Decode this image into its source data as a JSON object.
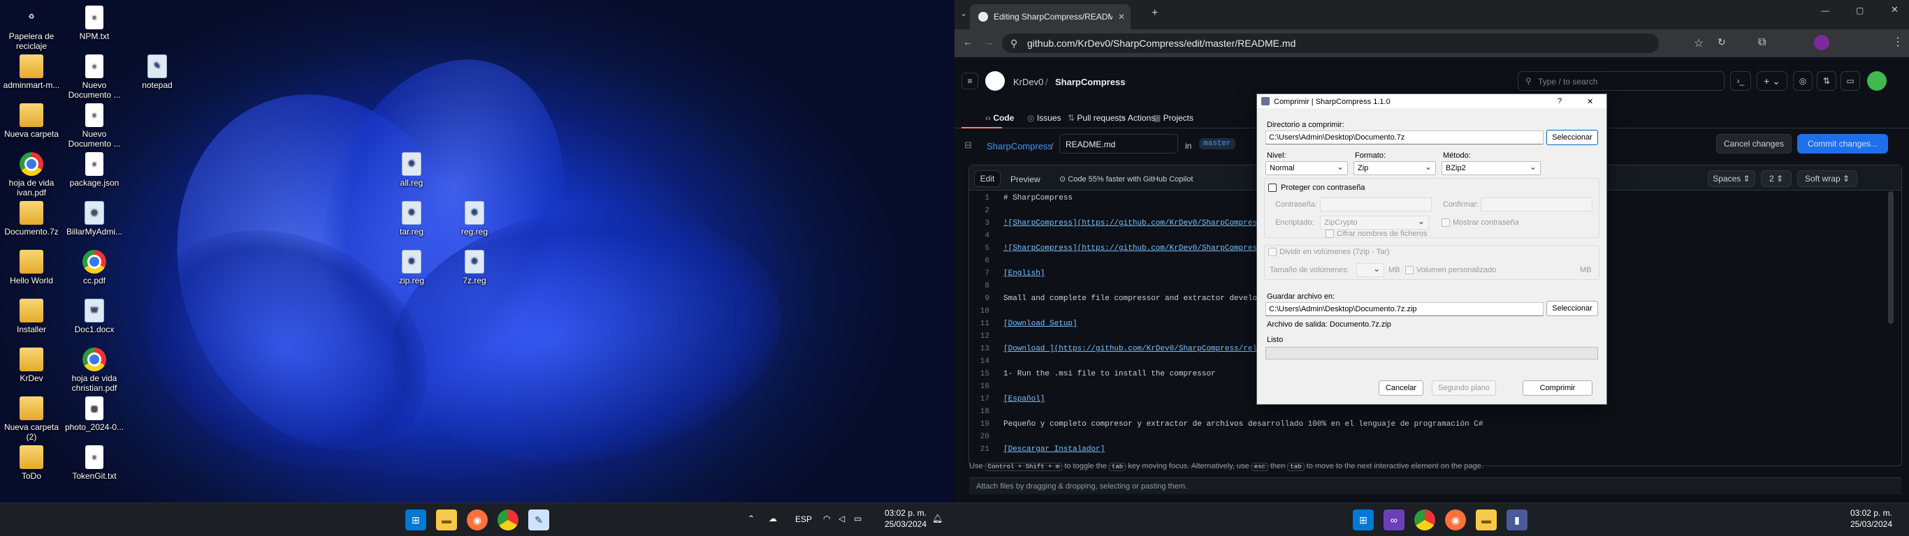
{
  "left_desktop": {
    "icons": [
      {
        "label": "Papelera de reciclaje",
        "kind": "bin",
        "glyph": "♻"
      },
      {
        "label": "NPM.txt",
        "kind": "doc",
        "glyph": "≡"
      },
      {
        "label": "adminmart-m...",
        "kind": "fold",
        "glyph": ""
      },
      {
        "label": "Nuevo Documento ...",
        "kind": "doc",
        "glyph": "≡"
      },
      {
        "label": "notepad",
        "kind": "reg",
        "glyph": "✎"
      },
      {
        "label": "Nueva carpeta",
        "kind": "fold",
        "glyph": ""
      },
      {
        "label": "Nuevo Documento ...",
        "kind": "doc",
        "glyph": "≡"
      },
      {
        "label": "hoja de vida ivan.pdf",
        "kind": "chr",
        "glyph": ""
      },
      {
        "label": "package.json",
        "kind": "doc",
        "glyph": "≡"
      },
      {
        "label": "Documento.7z",
        "kind": "fold",
        "glyph": ""
      },
      {
        "label": "BillarMyAdmi...",
        "kind": "reg",
        "glyph": "◎"
      },
      {
        "label": "Hello World",
        "kind": "fold",
        "glyph": ""
      },
      {
        "label": "cc.pdf",
        "kind": "chr",
        "glyph": ""
      },
      {
        "label": "Installer",
        "kind": "fold",
        "glyph": ""
      },
      {
        "label": "Doc1.docx",
        "kind": "reg",
        "glyph": "W"
      },
      {
        "label": "KrDev",
        "kind": "fold",
        "glyph": ""
      },
      {
        "label": "hoja de vida christian.pdf",
        "kind": "chr",
        "glyph": ""
      },
      {
        "label": "Nueva carpeta (2)",
        "kind": "fold",
        "glyph": ""
      },
      {
        "label": "photo_2024-0...",
        "kind": "doc",
        "glyph": "▦"
      },
      {
        "label": "ToDo",
        "kind": "fold",
        "glyph": ""
      },
      {
        "label": "TokenGit.txt",
        "kind": "doc",
        "glyph": "≡"
      },
      {
        "label": "all.reg",
        "kind": "reg",
        "glyph": "⚙"
      },
      {
        "label": "tar.reg",
        "kind": "reg",
        "glyph": "⚙"
      },
      {
        "label": "reg.reg",
        "kind": "reg",
        "glyph": "⚙"
      },
      {
        "label": "zip.reg",
        "kind": "reg",
        "glyph": "⚙"
      },
      {
        "label": "7z.reg",
        "kind": "reg",
        "glyph": "⚙"
      }
    ],
    "taskbar": {
      "lang": "ESP",
      "time": "03:02 p. m.",
      "date": "25/03/2024"
    }
  },
  "browser": {
    "tab_title": "Editing SharpCompress/README",
    "url": "github.com/KrDev0/SharpCompress/edit/master/README.md",
    "search_placeholder": "Type / to search",
    "owner": "KrDev0",
    "repo": "SharpCompress",
    "nav": [
      "Code",
      "Issues",
      "Pull requests",
      "Actions",
      "Projects"
    ],
    "breadcrumb_repo": "SharpCompress",
    "filename": "README.md",
    "branch_prefix": "in",
    "branch": "master",
    "cancel_label": "Cancel changes",
    "commit_label": "Commit changes...",
    "edit_tab": "Edit",
    "preview_tab": "Preview",
    "copilot_note": "Code 55% faster with GitHub Copilot",
    "indent_mode": "Spaces",
    "indent_size": "2",
    "wrap_mode": "Soft wrap",
    "lines": [
      {
        "n": "1",
        "t": "# SharpCompress",
        "link": false
      },
      {
        "n": "2",
        "t": "",
        "link": false
      },
      {
        "n": "3",
        "t": "![SharpCompress](https://github.com/KrDev0/SharpCompress/blob",
        "link": true
      },
      {
        "n": "4",
        "t": "",
        "link": false
      },
      {
        "n": "5",
        "t": "![SharpCompress](https://github.com/KrDev0/SharpCompress/blob",
        "link": true
      },
      {
        "n": "6",
        "t": "",
        "link": false
      },
      {
        "n": "7",
        "t": "[English]",
        "link": true
      },
      {
        "n": "8",
        "t": "",
        "link": false
      },
      {
        "n": "9",
        "t": "Small and complete file compressor and extractor developed 10",
        "link": false
      },
      {
        "n": "10",
        "t": "",
        "link": false
      },
      {
        "n": "11",
        "t": "[Download Setup]",
        "link": true
      },
      {
        "n": "12",
        "t": "",
        "link": false
      },
      {
        "n": "13",
        "t": "[Download ](https://github.com/KrDev0/SharpCompress/releases/",
        "link": true
      },
      {
        "n": "14",
        "t": "",
        "link": false
      },
      {
        "n": "15",
        "t": "1- Run the .msi file to install the compressor",
        "link": false
      },
      {
        "n": "16",
        "t": "",
        "link": false
      },
      {
        "n": "17",
        "t": "[Español]",
        "link": true
      },
      {
        "n": "18",
        "t": "",
        "link": false
      },
      {
        "n": "19",
        "t": "Pequeño y completo compresor y extractor de archivos desarrollado 100% en el lenguaje de programación C#",
        "link": false
      },
      {
        "n": "20",
        "t": "",
        "link": false
      },
      {
        "n": "21",
        "t": "[Descargar Instalador]",
        "link": true
      }
    ],
    "hint_prefix": "Use",
    "hint_keys1": "Control + Shift + m",
    "hint_mid": "to toggle the",
    "hint_key2": "tab",
    "hint_rest": "key moving focus. Alternatively, use",
    "hint_key3": "esc",
    "hint_then": "then",
    "hint_key4": "tab",
    "hint_end": "to move to the next interactive element on the page.",
    "attach_text": "Attach files by dragging & dropping, selecting or pasting them."
  },
  "dialog": {
    "title": "Comprimir | SharpCompress 1.1.0",
    "help": "?",
    "close": "✕",
    "dir_label": "Directorio a comprimir:",
    "dir_value": "C:\\Users\\Admin\\Desktop\\Documento.7z",
    "select1": "Seleccionar",
    "level_label": "Nivel:",
    "level_value": "Normal",
    "format_label": "Formato:",
    "format_value": "Zip",
    "method_label": "Método:",
    "method_value": "BZip2",
    "protect_label": "Proteger con contraseña",
    "password_label": "Contraseña:",
    "confirm_label": "Confirmar:",
    "encrypt_label": "Encriptado:",
    "encrypt_value": "ZipCrypto",
    "show_pw_label": "Mostrar contraseña",
    "encrypt_names_label": "Cifrar nombres de ficheros",
    "split_label": "Dividir en volúmenes (7zip - Tar)",
    "vol_size_label": "Tamaño de volúmenes:",
    "vol_unit": "MB",
    "custom_vol_label": "Volumen personalizado",
    "custom_unit": "MB",
    "save_label": "Guardar archivo en:",
    "save_value": "C:\\Users\\Admin\\Desktop\\Documento.7z.zip",
    "select2": "Seleccionar",
    "output_text": "Archivo de salida: Documento.7z.zip",
    "status_text": "Listo",
    "progress": 0,
    "cancel": "Cancelar",
    "background": "Segundo plano",
    "compress": "Comprimir"
  },
  "right_taskbar": {
    "time": "03:02 p. m.",
    "date": "25/03/2024"
  }
}
